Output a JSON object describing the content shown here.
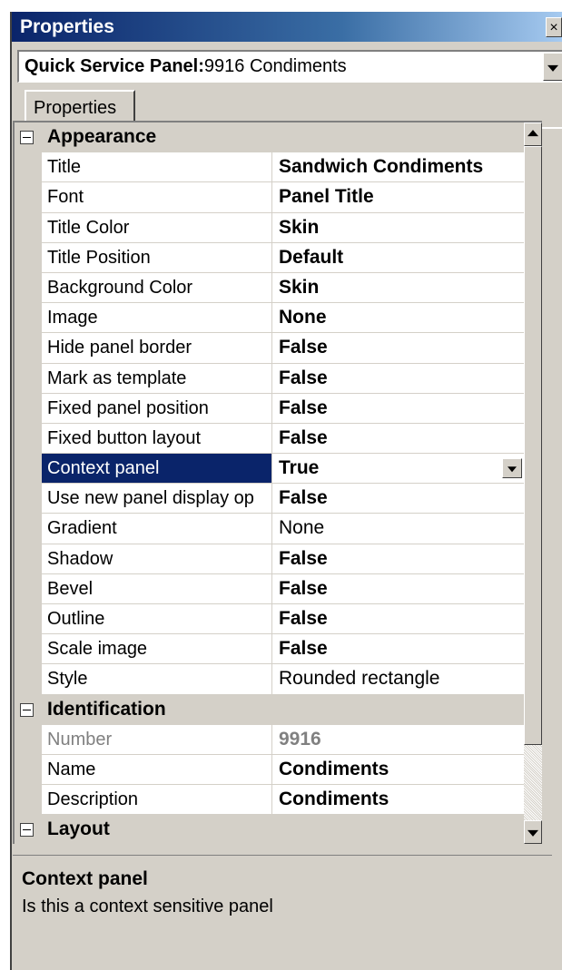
{
  "window": {
    "title": "Properties",
    "close_glyph": "×"
  },
  "object_selector": {
    "type_label": "Quick Service Panel:",
    "object_label": "9916 Condiments"
  },
  "tabs": [
    {
      "label": "Properties",
      "active": true
    }
  ],
  "grid": {
    "rows": [
      {
        "kind": "category",
        "label": "Appearance",
        "expanded": true
      },
      {
        "kind": "property",
        "name": "Title",
        "value": "Sandwich Condiments",
        "bold": true
      },
      {
        "kind": "property",
        "name": "Font",
        "value": "Panel Title",
        "bold": true
      },
      {
        "kind": "property",
        "name": "Title Color",
        "value": "Skin",
        "bold": true
      },
      {
        "kind": "property",
        "name": "Title Position",
        "value": "Default",
        "bold": true
      },
      {
        "kind": "property",
        "name": "Background Color",
        "value": "Skin",
        "bold": true
      },
      {
        "kind": "property",
        "name": "Image",
        "value": "None",
        "bold": true
      },
      {
        "kind": "property",
        "name": "Hide panel border",
        "value": "False",
        "bold": true
      },
      {
        "kind": "property",
        "name": "Mark as template",
        "value": "False",
        "bold": true
      },
      {
        "kind": "property",
        "name": "Fixed panel position",
        "value": "False",
        "bold": true
      },
      {
        "kind": "property",
        "name": "Fixed button layout",
        "value": "False",
        "bold": true
      },
      {
        "kind": "property",
        "name": "Context panel",
        "value": "True",
        "bold": true,
        "selected": true,
        "dropdown": true
      },
      {
        "kind": "property",
        "name": "Use new panel display op",
        "value": "False",
        "bold": true
      },
      {
        "kind": "property",
        "name": "Gradient",
        "value": "None",
        "bold": false
      },
      {
        "kind": "property",
        "name": "Shadow",
        "value": "False",
        "bold": true
      },
      {
        "kind": "property",
        "name": "Bevel",
        "value": "False",
        "bold": true
      },
      {
        "kind": "property",
        "name": "Outline",
        "value": "False",
        "bold": true
      },
      {
        "kind": "property",
        "name": "Scale image",
        "value": "False",
        "bold": true
      },
      {
        "kind": "property",
        "name": "Style",
        "value": "Rounded rectangle",
        "bold": false
      },
      {
        "kind": "category",
        "label": "Identification",
        "expanded": true
      },
      {
        "kind": "property",
        "name": "Number",
        "value": "9916",
        "bold": true,
        "disabled": true
      },
      {
        "kind": "property",
        "name": "Name",
        "value": "Condiments",
        "bold": true
      },
      {
        "kind": "property",
        "name": "Description",
        "value": "Condiments",
        "bold": true
      },
      {
        "kind": "category",
        "label": "Layout",
        "expanded": true
      }
    ]
  },
  "help": {
    "title": "Context panel",
    "description": "Is this a context sensitive panel"
  },
  "colors": {
    "titlebar_start": "#0a246a",
    "titlebar_end": "#a6caf0",
    "selection": "#0a246a",
    "chrome": "#d4d0c8"
  }
}
